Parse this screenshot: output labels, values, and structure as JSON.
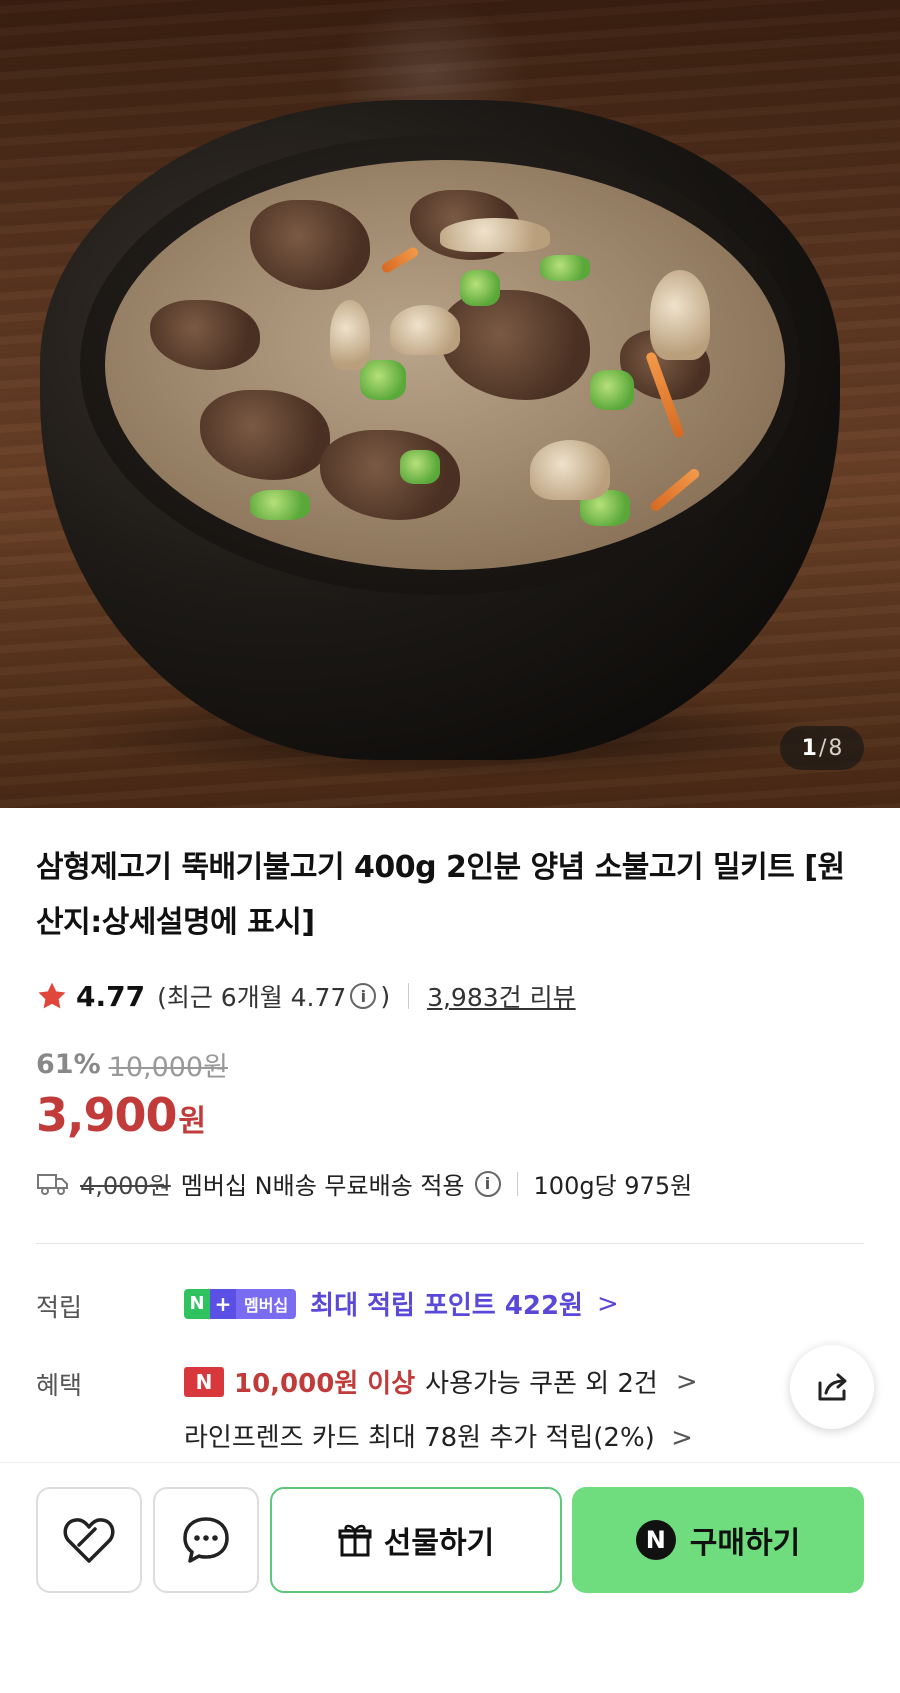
{
  "gallery": {
    "current": "1",
    "separator": "/",
    "total": "8"
  },
  "product": {
    "title": "삼형제고기 뚝배기불고기 400g 2인분 양념 소불고기 밀키트 [원산지:상세설명에 표시]"
  },
  "rating": {
    "score": "4.77",
    "recent": "(최근 6개월 4.77",
    "recent_close": ")",
    "reviews": "3,983건 리뷰"
  },
  "price": {
    "discount": "61%",
    "original": "10,000원",
    "sale": "3,900",
    "sale_unit": "원"
  },
  "shipping": {
    "fee_strike": "4,000원",
    "text": "멤버십 N배송 무료배송 적용",
    "unit_price": "100g당 975원"
  },
  "points": {
    "label": "적립",
    "badge_n": "N",
    "badge_plus": "+",
    "badge_text": "멤버십",
    "text": "최대 적립 포인트 422원",
    "chevron": ">"
  },
  "benefits": {
    "label": "혜택",
    "coupon_badge": "N",
    "coupon_min": "10,000원 이상",
    "coupon_text": "사용가능 쿠폰 외 2건",
    "card_text": "라인프렌즈 카드 최대 78원 추가 적립(2%)",
    "chevron": ">"
  },
  "actions": {
    "gift_label": "선물하기",
    "buy_label": "구매하기",
    "buy_icon": "N"
  },
  "colors": {
    "sale_red": "#c23b3b",
    "points_purple": "#5a48d8",
    "buy_green": "#6fdc7d",
    "gift_border": "#5fc77a",
    "star_red": "#e0463a"
  }
}
